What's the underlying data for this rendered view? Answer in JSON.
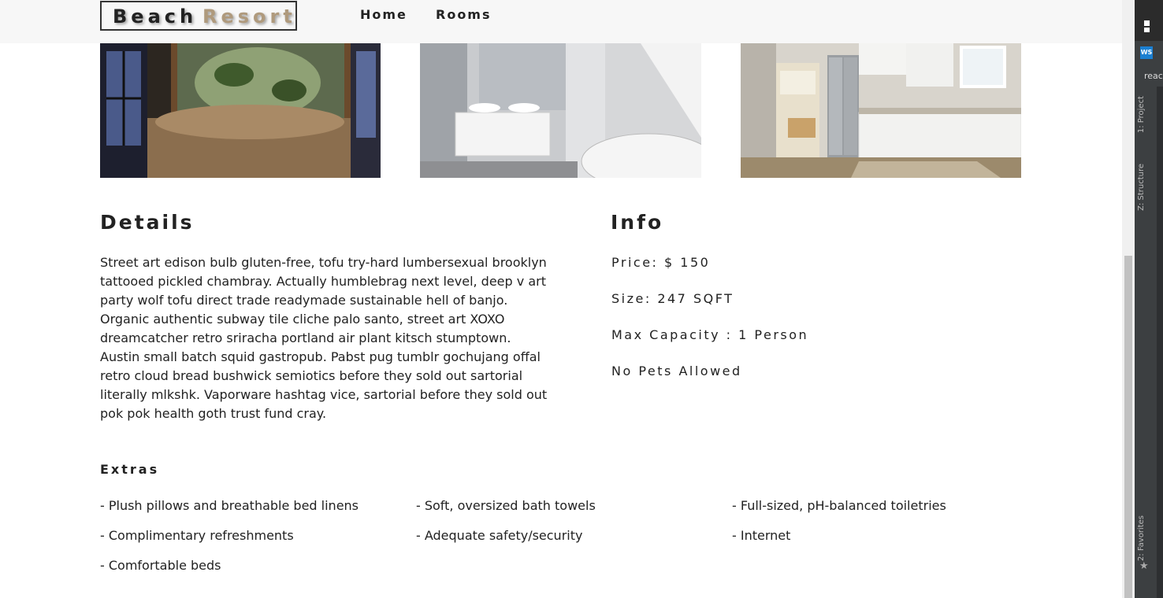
{
  "navbar": {
    "logo_part1": "Beach",
    "logo_part2": "Resort",
    "links": [
      "Home",
      "Rooms"
    ]
  },
  "gallery": {
    "images": [
      "bedroom-photo",
      "bathroom-photo",
      "kitchen-photo"
    ]
  },
  "details": {
    "heading": "Details",
    "text": "Street art edison bulb gluten-free, tofu try-hard lumbersexual brooklyn tattooed pickled chambray. Actually humblebrag next level, deep v art party wolf tofu direct trade readymade sustainable hell of banjo. Organic authentic subway tile cliche palo santo, street art XOXO dreamcatcher retro sriracha portland air plant kitsch stumptown. Austin small batch squid gastropub. Pabst pug tumblr gochujang offal retro cloud bread bushwick semiotics before they sold out sartorial literally mlkshk. Vaporware hashtag vice, sartorial before they sold out pok pok health goth trust fund cray."
  },
  "info": {
    "heading": "Info",
    "price": "Price: $ 150",
    "size": "Size: 247 SQFT",
    "capacity": "Max Capacity : 1 Person",
    "pets": "No Pets Allowed"
  },
  "extras": {
    "heading": "Extras",
    "items": [
      "- Plush pillows and breathable bed linens",
      "- Soft, oversized bath towels",
      "- Full-sized, pH-balanced toiletries",
      "- Complimentary refreshments",
      "- Adequate safety/security",
      "- Internet",
      "- Comfortable beds"
    ]
  },
  "ide": {
    "tab_project": "1: Project",
    "tab_structure": "Z: Structure",
    "tab_favorites": "2: Favorites",
    "label": "reac"
  },
  "colors": {
    "accent": "#af9a7d",
    "navbar_bg": "#f7f7f7",
    "text": "#222222"
  }
}
